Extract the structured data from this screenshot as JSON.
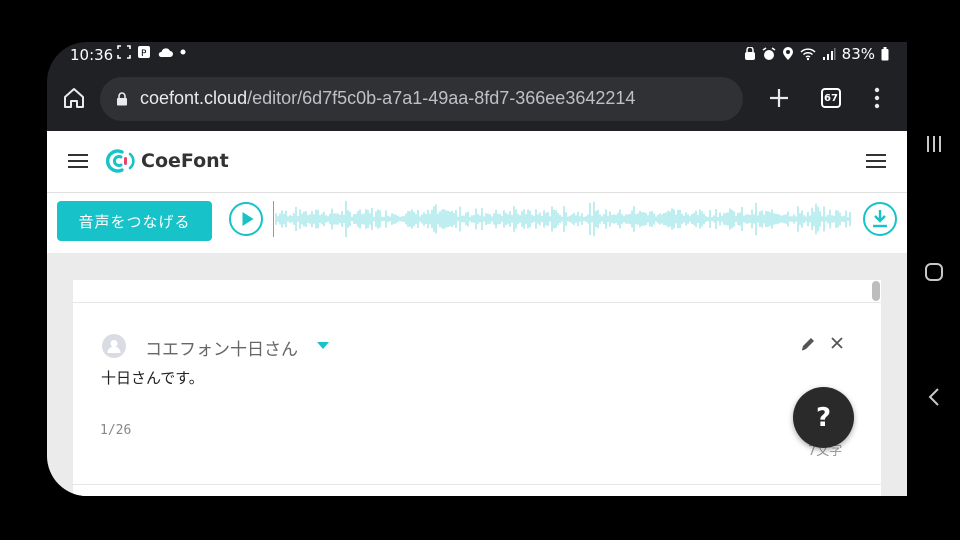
{
  "status": {
    "time": "10:36",
    "battery": "83%"
  },
  "browser": {
    "url_host": "coefont.cloud",
    "url_path": "/editor/6d7f5c0b-a7a1-49aa-8fd7-366ee3642214",
    "tab_count": "67"
  },
  "site": {
    "logo_text": "CoeFont",
    "join_button": "音声をつなげる"
  },
  "card": {
    "speaker_name": "コエフォン十日さん",
    "text": "十日さんです。",
    "page_count": "1/26",
    "char_count": "7文字"
  },
  "help": {
    "label": "?"
  },
  "colors": {
    "accent": "#17c3c8",
    "browser_bg": "#202124",
    "omnibox": "#303134"
  }
}
